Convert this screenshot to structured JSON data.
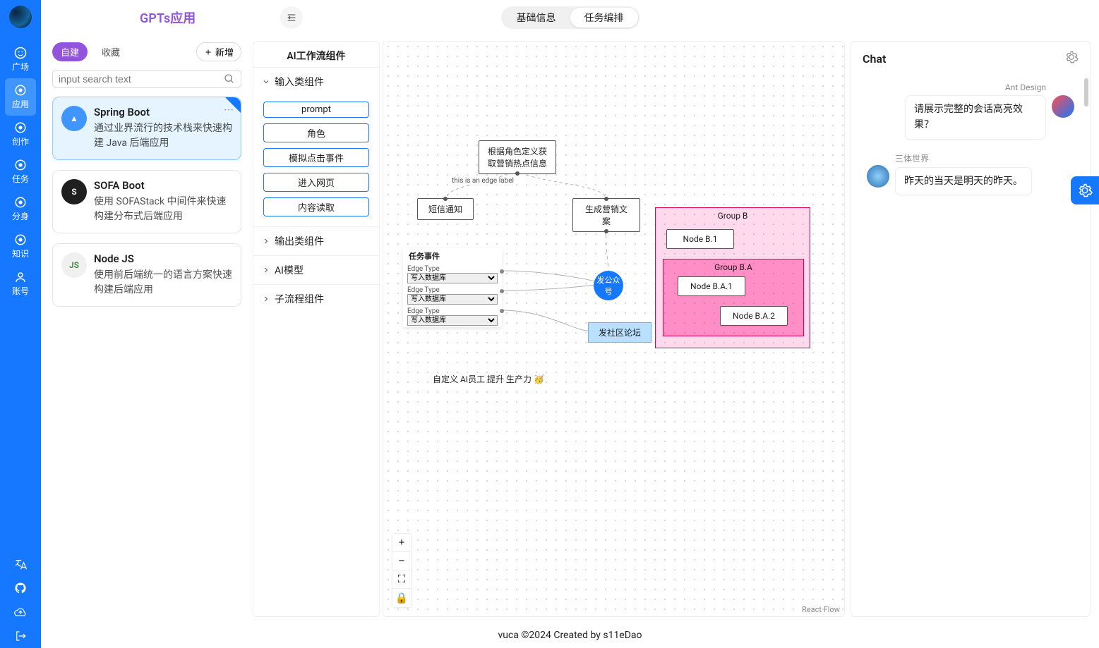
{
  "header": {
    "app_title": "GPTs应用",
    "tab_basic": "基础信息",
    "tab_orchestrate": "任务编排"
  },
  "rail": {
    "items": [
      {
        "label": "广场"
      },
      {
        "label": "应用"
      },
      {
        "label": "创作"
      },
      {
        "label": "任务"
      },
      {
        "label": "分身"
      },
      {
        "label": "知识"
      },
      {
        "label": "账号"
      }
    ]
  },
  "apps_panel": {
    "tab_built": "自建",
    "tab_fav": "收藏",
    "new_btn": "新增",
    "search_placeholder": "input search text",
    "cards": [
      {
        "name": "Spring Boot",
        "desc": "通过业界流行的技术栈来快速构建 Java 后端应用",
        "icon_bg": "#4096ff",
        "icon_txt": "▲"
      },
      {
        "name": "SOFA Boot",
        "desc": "使用 SOFAStack 中间件来快速构建分布式后端应用",
        "icon_bg": "#1f1f1f",
        "icon_txt": "S"
      },
      {
        "name": "Node JS",
        "desc": "使用前后端统一的语言方案快速构建后端应用",
        "icon_bg": "#f0f0f0",
        "icon_txt": "JS"
      }
    ]
  },
  "flow_sidebar": {
    "title": "AI工作流组件",
    "cat_input": "输入类组件",
    "cat_output": "输出类组件",
    "cat_model": "AI模型",
    "cat_sub": "子流程组件",
    "input_items": [
      "prompt",
      "角色",
      "模拟点击事件",
      "进入网页",
      "内容读取"
    ]
  },
  "canvas": {
    "nodes": {
      "hot_info": "根据角色定义获取营销热点信息",
      "sms": "短信通知",
      "gen_copy": "生成营销文案",
      "group_b": "Group B",
      "node_b1": "Node B.1",
      "group_ba": "Group B.A",
      "node_ba1": "Node B.A.1",
      "node_ba2": "Node B.A.2",
      "circle": "发公众号",
      "forum": "发社区论坛",
      "form_title": "任务事件",
      "form_label": "Edge Type",
      "form_opt": "写入数据库",
      "annotation": "自定义 AI员工 提升 生产力 🥳",
      "edge_label": "this is an edge label"
    },
    "controls": {
      "zoom_in": "+",
      "zoom_out": "−",
      "fit": "⛶",
      "lock": "🔒"
    },
    "rf": "React Flow"
  },
  "chat": {
    "title": "Chat",
    "messages": [
      {
        "side": "right",
        "name": "Ant Design",
        "text": "请展示完整的会话高亮效果？"
      },
      {
        "side": "left",
        "name": "三体世界",
        "text": "昨天的当天是明天的昨天。"
      }
    ]
  },
  "footer": "vuca ©2024 Created by s11eDao"
}
